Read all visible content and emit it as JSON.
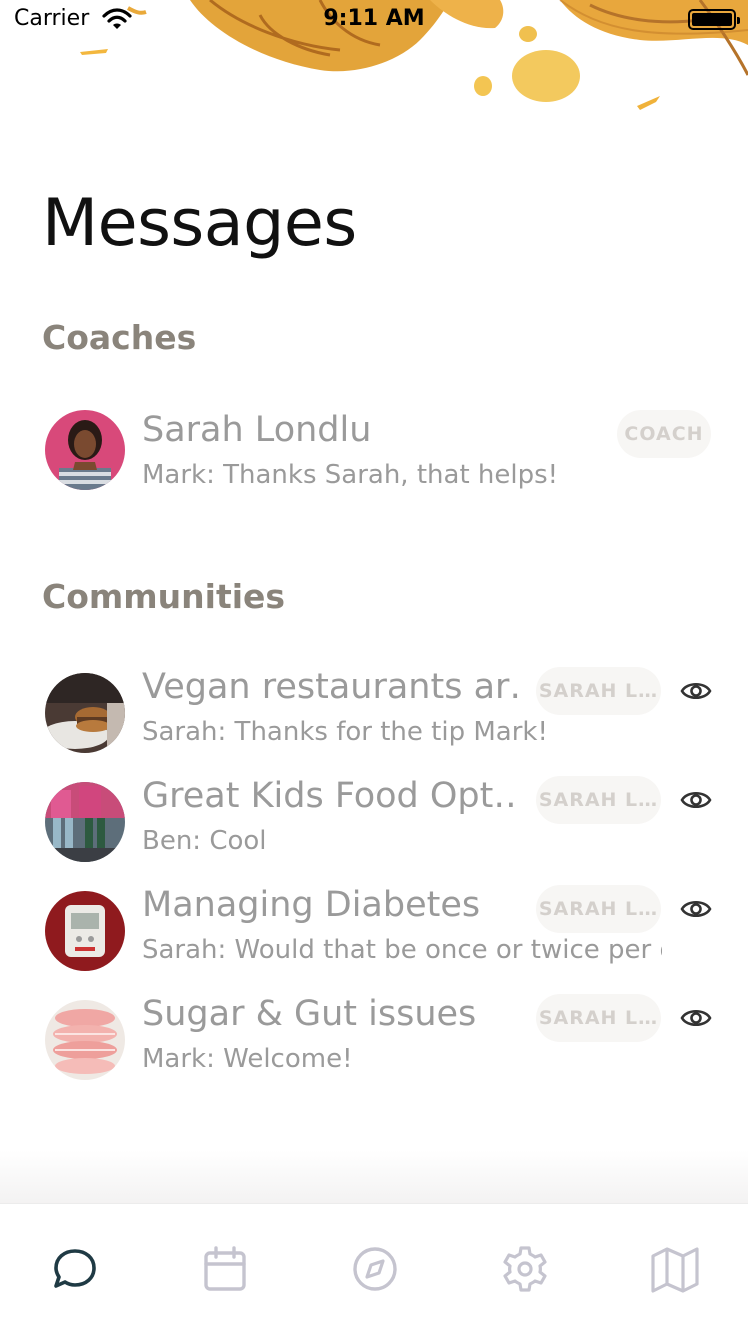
{
  "status_bar": {
    "carrier": "Carrier",
    "time": "9:11 AM"
  },
  "page_title": "Messages",
  "coaches": {
    "heading": "Coaches",
    "items": [
      {
        "name": "Sarah Londlu",
        "last_message": "Mark: Thanks Sarah, that helps!",
        "badge": "COACH"
      }
    ]
  },
  "communities": {
    "heading": "Communities",
    "items": [
      {
        "name": "Vegan restaurants ar…",
        "last_message": "Sarah: Thanks for the tip Mark!",
        "badge": "SARAH L…",
        "icon": "eye-icon"
      },
      {
        "name": "Great Kids Food Opt…",
        "last_message": "Ben: Cool",
        "badge": "SARAH L…",
        "icon": "eye-icon"
      },
      {
        "name": "Managing Diabetes",
        "last_message": "Sarah: Would that be once or twice per d",
        "badge": "SARAH L…",
        "icon": "eye-icon"
      },
      {
        "name": "Sugar & Gut issues",
        "last_message": "Mark: Welcome!",
        "badge": "SARAH L…",
        "icon": "eye-icon"
      }
    ]
  },
  "tab_bar": {
    "tabs": [
      {
        "icon": "chat-icon",
        "active": true
      },
      {
        "icon": "calendar-icon",
        "active": false
      },
      {
        "icon": "compass-icon",
        "active": false
      },
      {
        "icon": "gear-icon",
        "active": false
      },
      {
        "icon": "map-icon",
        "active": false
      }
    ],
    "active_color": "#1f3a44",
    "inactive_color": "#c5c4cf"
  },
  "colors": {
    "section_heading": "#8a847b",
    "row_text": "#9a9a9a",
    "badge_bg": "#f7f6f4",
    "badge_text": "#d4d0cc"
  }
}
